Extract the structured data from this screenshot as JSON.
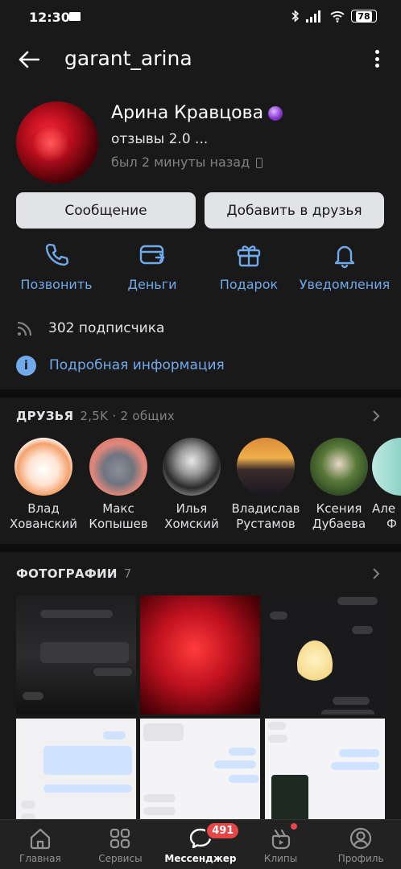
{
  "status_bar": {
    "time": "12:30",
    "battery": "78"
  },
  "header": {
    "title": "garant_arina"
  },
  "profile": {
    "name": "Арина Кравцова",
    "status": "отзывы 2.0 ...",
    "online": "был 2 минуты назад"
  },
  "buttons": {
    "message": "Сообщение",
    "add_friend": "Добавить в друзья"
  },
  "quick_actions": [
    {
      "label": "Позвонить",
      "icon": "phone-icon"
    },
    {
      "label": "Деньги",
      "icon": "money-icon"
    },
    {
      "label": "Подарок",
      "icon": "gift-icon"
    },
    {
      "label": "Уведомления",
      "icon": "bell-icon"
    }
  ],
  "subscribers": "302 подписчика",
  "details_link": "Подробная информация",
  "friends": {
    "title": "ДРУЗЬЯ",
    "count": "2,5K · 2 общих",
    "items": [
      {
        "name1": "Влад",
        "name2": "Хованский"
      },
      {
        "name1": "Макс",
        "name2": "Копышев"
      },
      {
        "name1": "Илья",
        "name2": "Хомский"
      },
      {
        "name1": "Владислав",
        "name2": "Рустамов"
      },
      {
        "name1": "Ксения",
        "name2": "Дубаева"
      },
      {
        "name1": "Але",
        "name2": "Ф"
      }
    ]
  },
  "photos": {
    "title": "ФОТОГРАФИИ",
    "count": "7"
  },
  "tabbar": {
    "items": [
      {
        "label": "Главная"
      },
      {
        "label": "Сервисы"
      },
      {
        "label": "Мессенджер",
        "badge": "491"
      },
      {
        "label": "Клипы"
      },
      {
        "label": "Профиль"
      }
    ]
  },
  "colors": {
    "accent": "#71aaeb",
    "background": "#19191a",
    "badge": "#e64646"
  }
}
